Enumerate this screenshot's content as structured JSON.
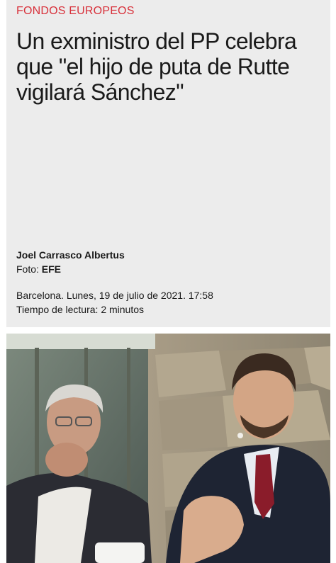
{
  "article": {
    "section": "FONDOS EUROPEOS",
    "title": "Un exministro del PP celebra que \"el hijo de puta de Rutte vigilará Sánchez\"",
    "author": "Joel Carrasco Albertus",
    "photo_label": "Foto:",
    "photo_source": "EFE",
    "dateline": "Barcelona. Lunes, 19 de julio de 2021. 17:58",
    "reading_time": "Tiempo de lectura: 2 minutos"
  },
  "colors": {
    "section_accent": "#d8303a",
    "card_background": "#ececec",
    "text": "#1a1a1a"
  }
}
